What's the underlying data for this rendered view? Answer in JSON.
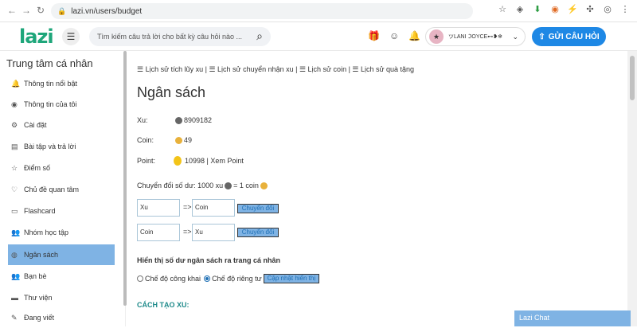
{
  "browser": {
    "url": "lazi.vn/users/budget"
  },
  "header": {
    "logo": "lazi",
    "search_placeholder": "Tìm kiếm câu trả lời cho bất kỳ câu hỏi nào ...",
    "user_name": "ツLANI ℑOYCE⊷❥❄",
    "ask_button": "GỬI CÂU HỎI"
  },
  "sidebar": {
    "title": "Trung tâm cá nhân",
    "items": [
      {
        "label": "Thông tin nổi bật",
        "icon": "bell-icon"
      },
      {
        "label": "Thông tin của tôi",
        "icon": "user-circle-icon"
      },
      {
        "label": "Cài đặt",
        "icon": "gear-icon"
      },
      {
        "label": "Bài tập và trả lời",
        "icon": "book-icon"
      },
      {
        "label": "Điểm số",
        "icon": "star-icon"
      },
      {
        "label": "Chủ đề quan tâm",
        "icon": "heart-icon"
      },
      {
        "label": "Flashcard",
        "icon": "card-icon"
      },
      {
        "label": "Nhóm học tập",
        "icon": "group-icon"
      },
      {
        "label": "Ngân sách",
        "icon": "coins-icon"
      },
      {
        "label": "Bạn bè",
        "icon": "friends-icon"
      },
      {
        "label": "Thư viện",
        "icon": "folder-icon"
      },
      {
        "label": "Đang viết",
        "icon": "pen-icon"
      }
    ]
  },
  "main": {
    "history_links": "☰ Lịch sử tích lũy xu | ☰ Lịch sử chuyển nhận xu | ☰ Lịch sử coin | ☰ Lịch sử quà tặng",
    "title": "Ngân sách",
    "xu_label": "Xu:",
    "xu_value": "8909182",
    "coin_label": "Coin:",
    "coin_value": "49",
    "point_label": "Point:",
    "point_value": "10998 | Xem Point",
    "conversion_rate": "Chuyển đổi số dư: 1000 xu",
    "conversion_rate_suffix": "= 1 coin",
    "conv1_from": "Xu",
    "conv1_arrow": "=>",
    "conv1_to": "Coin",
    "conv2_from": "Coin",
    "conv2_arrow": "=>",
    "conv2_to": "Xu",
    "convert_button": "Chuyển đổi",
    "display_label": "Hiển thị số dư ngân sách ra trang cá nhân",
    "public_mode": "Chế độ công khai",
    "private_mode": "Chế độ riêng tư",
    "update_button": "Cập nhật hiển thị",
    "create_xu": "CÁCH TẠO XU:"
  },
  "chat": {
    "label": "Lazi Chat"
  }
}
